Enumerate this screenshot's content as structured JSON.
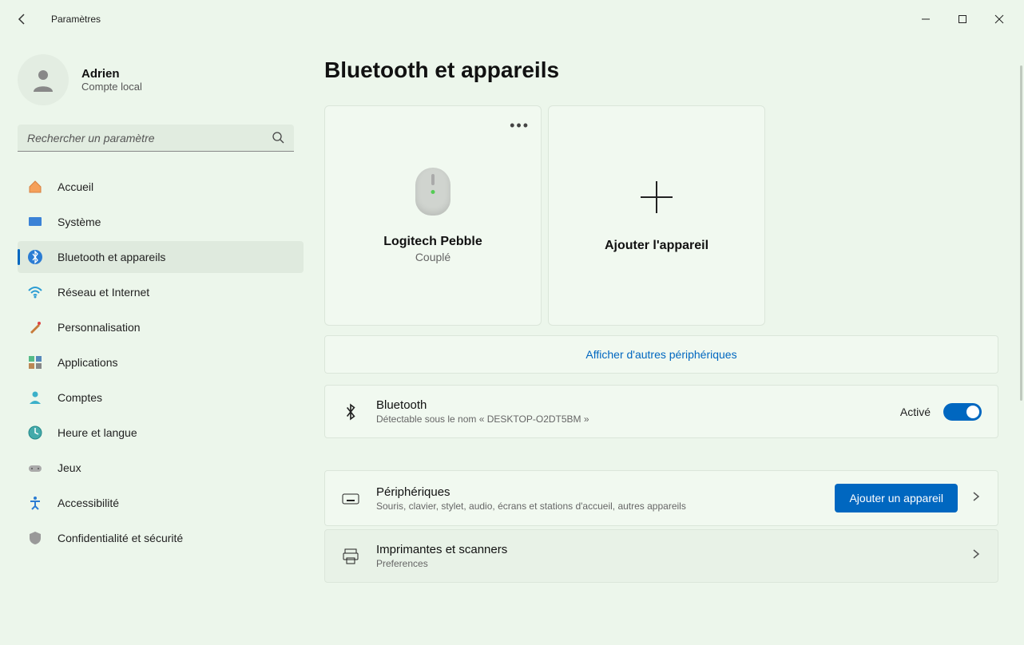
{
  "titlebar": {
    "title": "Paramètres"
  },
  "user": {
    "name": "Adrien",
    "subtitle": "Compte local"
  },
  "search": {
    "placeholder": "Rechercher un paramètre"
  },
  "nav": {
    "items": [
      {
        "label": "Accueil"
      },
      {
        "label": "Système"
      },
      {
        "label": "Bluetooth et appareils"
      },
      {
        "label": "Réseau et Internet"
      },
      {
        "label": "Personnalisation"
      },
      {
        "label": "Applications"
      },
      {
        "label": "Comptes"
      },
      {
        "label": "Heure et langue"
      },
      {
        "label": "Jeux"
      },
      {
        "label": "Accessibilité"
      },
      {
        "label": "Confidentialité et sécurité"
      }
    ]
  },
  "page": {
    "title": "Bluetooth et appareils"
  },
  "devices": {
    "card": {
      "name": "Logitech Pebble",
      "status": "Couplé"
    },
    "add": {
      "label": "Ajouter l'appareil"
    },
    "more_link": "Afficher d'autres périphériques"
  },
  "bluetooth": {
    "title": "Bluetooth",
    "subtitle": "Détectable sous le nom « DESKTOP-O2DT5BM »",
    "status": "Activé"
  },
  "peripherals": {
    "title": "Périphériques",
    "subtitle": "Souris, clavier, stylet, audio, écrans et stations d'accueil, autres appareils",
    "button": "Ajouter un appareil"
  },
  "printers": {
    "title": "Imprimantes et scanners",
    "subtitle": "Preferences"
  }
}
